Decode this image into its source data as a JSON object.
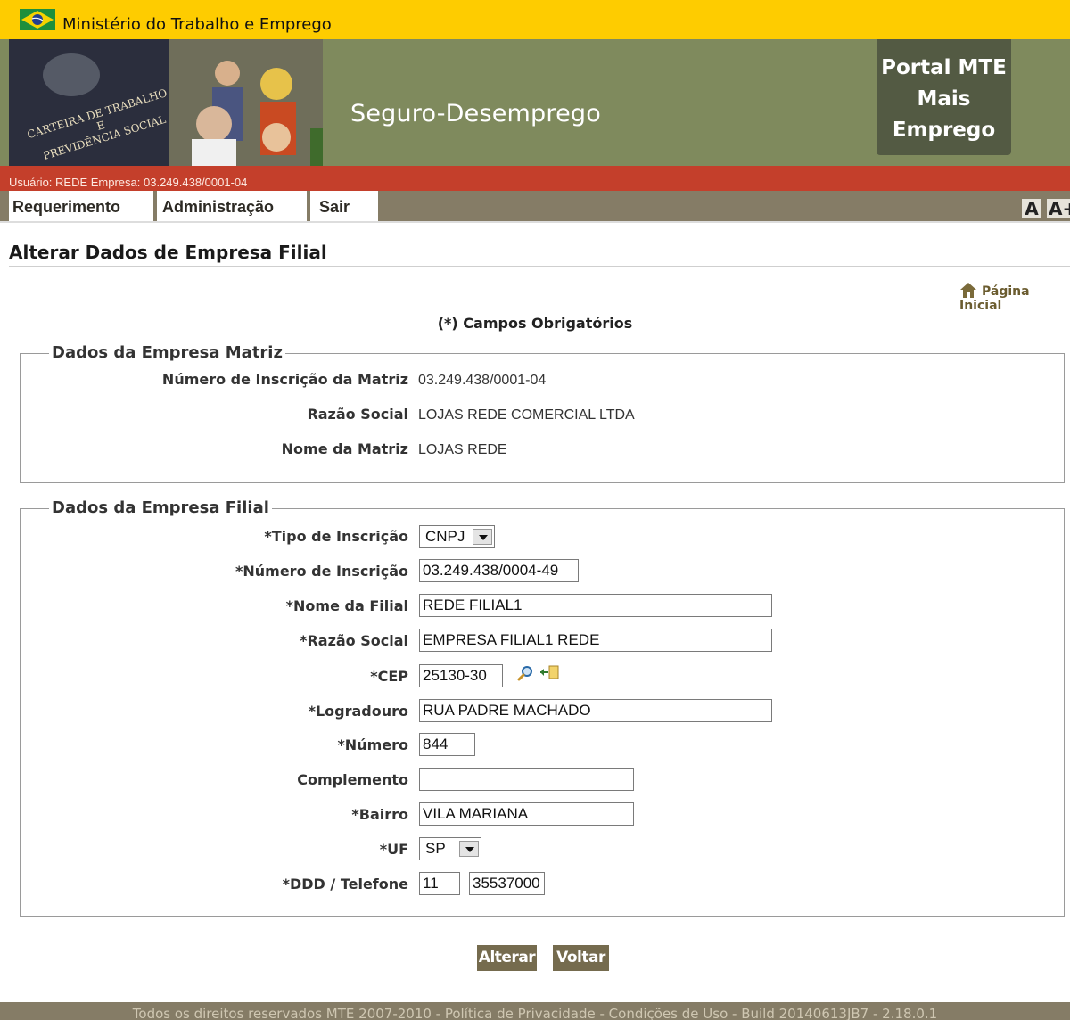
{
  "gov": {
    "title": "Ministério do Trabalho e Emprego",
    "flag_icon": "brazil-flag-icon"
  },
  "banner": {
    "system_name": "Seguro-Desemprego",
    "portal_lines": [
      "Portal MTE",
      "Mais",
      "Emprego"
    ],
    "photo_text": [
      "CARTEIRA DE TRABALHO",
      "E",
      "PREVIDÊNCIA SOCIAL"
    ]
  },
  "user": {
    "text": "Usuário: REDE Empresa: 03.249.438/0001-04"
  },
  "menu": {
    "items": [
      "Requerimento",
      "Administração",
      "Sair"
    ],
    "font_small": "A",
    "font_large": "A+"
  },
  "page": {
    "title": "Alterar Dados de Empresa Filial",
    "home_link": "Página Inicial",
    "required_note": "(*) Campos Obrigatórios"
  },
  "matriz": {
    "legend": "Dados da Empresa Matriz",
    "fields": [
      {
        "label": "Número de Inscrição da Matriz",
        "value": "03.249.438/0001-04"
      },
      {
        "label": "Razão Social",
        "value": "LOJAS REDE COMERCIAL LTDA"
      },
      {
        "label": "Nome da Matriz",
        "value": "LOJAS REDE"
      }
    ]
  },
  "filial": {
    "legend": "Dados da Empresa Filial",
    "tipo_inscricao": {
      "label": "*Tipo de Inscrição",
      "value": "CNPJ"
    },
    "numero_inscricao": {
      "label": "*Número de Inscrição",
      "value": "03.249.438/0004-49"
    },
    "nome_filial": {
      "label": "*Nome da Filial",
      "value": "REDE FILIAL1"
    },
    "razao_social": {
      "label": "*Razão Social",
      "value": "EMPRESA FILIAL1 REDE"
    },
    "cep": {
      "label": "*CEP",
      "value": "25130-30"
    },
    "logradouro": {
      "label": "*Logradouro",
      "value": "RUA PADRE MACHADO"
    },
    "numero": {
      "label": "*Número",
      "value": "844"
    },
    "complemento": {
      "label": "Complemento",
      "value": ""
    },
    "bairro": {
      "label": "*Bairro",
      "value": "VILA MARIANA"
    },
    "uf": {
      "label": "*UF",
      "value": "SP"
    },
    "telefone": {
      "label": "*DDD / Telefone",
      "ddd": "11",
      "numero": "35537000"
    }
  },
  "actions": {
    "alterar": "Alterar",
    "voltar": "Voltar"
  },
  "footer": {
    "text": "Todos os direitos reservados MTE 2007-2010 - Política de Privacidade - Condições de Uso - Build 20140613JB7 - 2.18.0.1"
  },
  "colors": {
    "gov_yellow": "#fecc00",
    "banner_olive": "#7f8a5d",
    "user_red": "#c43f2b",
    "menu_taupe": "#857c66",
    "button": "#756b4e"
  }
}
